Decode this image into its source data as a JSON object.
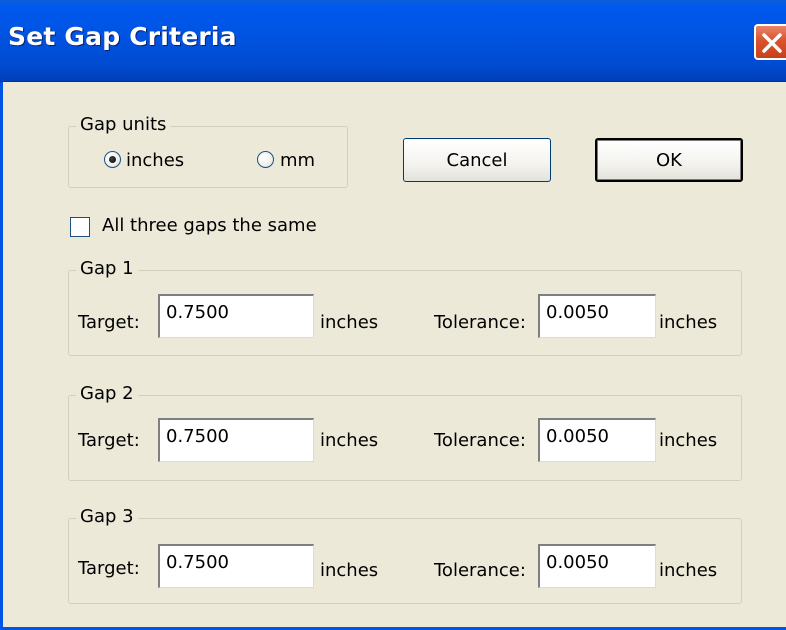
{
  "window": {
    "title": "Set Gap Criteria"
  },
  "units_group": {
    "legend": "Gap units",
    "options": [
      {
        "label": "inches",
        "selected": true
      },
      {
        "label": "mm",
        "selected": false
      }
    ]
  },
  "buttons": {
    "cancel": "Cancel",
    "ok": "OK"
  },
  "same_gaps": {
    "label": "All three gaps the same",
    "checked": false
  },
  "gaps": [
    {
      "legend": "Gap 1",
      "target_label": "Target:",
      "target_value": "0.7500",
      "target_unit": "inches",
      "tolerance_label": "Tolerance:",
      "tolerance_value": "0.0050",
      "tolerance_unit": "inches"
    },
    {
      "legend": "Gap 2",
      "target_label": "Target:",
      "target_value": "0.7500",
      "target_unit": "inches",
      "tolerance_label": "Tolerance:",
      "tolerance_value": "0.0050",
      "tolerance_unit": "inches"
    },
    {
      "legend": "Gap 3",
      "target_label": "Target:",
      "target_value": "0.7500",
      "target_unit": "inches",
      "tolerance_label": "Tolerance:",
      "tolerance_value": "0.0050",
      "tolerance_unit": "inches"
    }
  ],
  "colors": {
    "titlebar": "#0054e3",
    "dialog_bg": "#ece9d8",
    "close_button": "#d9542c"
  },
  "icons": {
    "close": "close-x-icon"
  }
}
